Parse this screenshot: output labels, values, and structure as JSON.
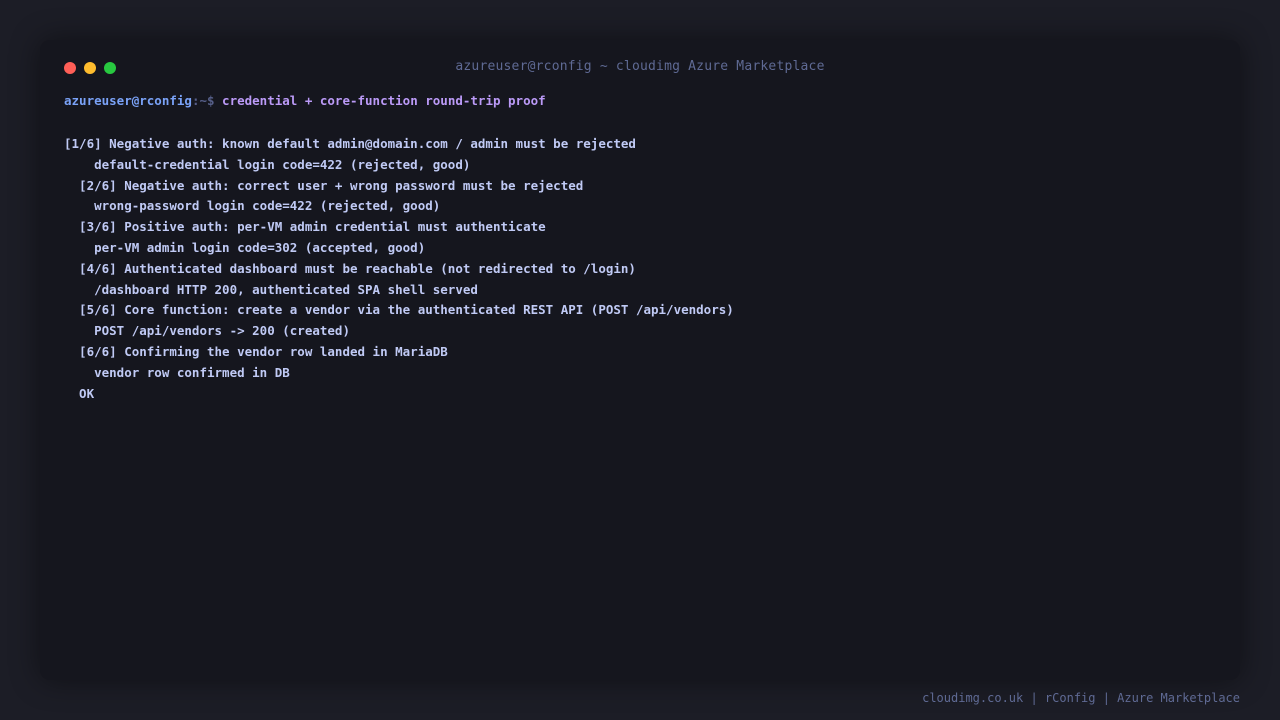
{
  "window": {
    "title": "azureuser@rconfig ~ cloudimg Azure Marketplace",
    "buttons": [
      {
        "name": "close",
        "color": "#ff5f57"
      },
      {
        "name": "minimize",
        "color": "#febc2e"
      },
      {
        "name": "maximize",
        "color": "#28c840"
      }
    ]
  },
  "prompt": {
    "user_host": "azureuser@rconfig",
    "path_symbol": ":~$",
    "command": "credential + core-function round-trip proof"
  },
  "output_lines": [
    "[1/6] Negative auth: known default admin@domain.com / admin must be rejected",
    "    default-credential login code=422 (rejected, good)",
    "  [2/6] Negative auth: correct user + wrong password must be rejected",
    "    wrong-password login code=422 (rejected, good)",
    "  [3/6] Positive auth: per-VM admin credential must authenticate",
    "    per-VM admin login code=302 (accepted, good)",
    "  [4/6] Authenticated dashboard must be reachable (not redirected to /login)",
    "    /dashboard HTTP 200, authenticated SPA shell served",
    "  [5/6] Core function: create a vendor via the authenticated REST API (POST /api/vendors)",
    "    POST /api/vendors -> 200 (created)",
    "  [6/6] Confirming the vendor row landed in MariaDB",
    "    vendor row confirmed in DB",
    "  OK"
  ],
  "footer": "cloudimg.co.uk | rConfig | Azure Marketplace",
  "colors": {
    "background": "#1c1d26",
    "terminal_bg": "#15161e",
    "prompt_user": "#7aa2f7",
    "prompt_command": "#bb9af7",
    "output_text": "#c0caf5",
    "muted": "#5f6a94"
  }
}
